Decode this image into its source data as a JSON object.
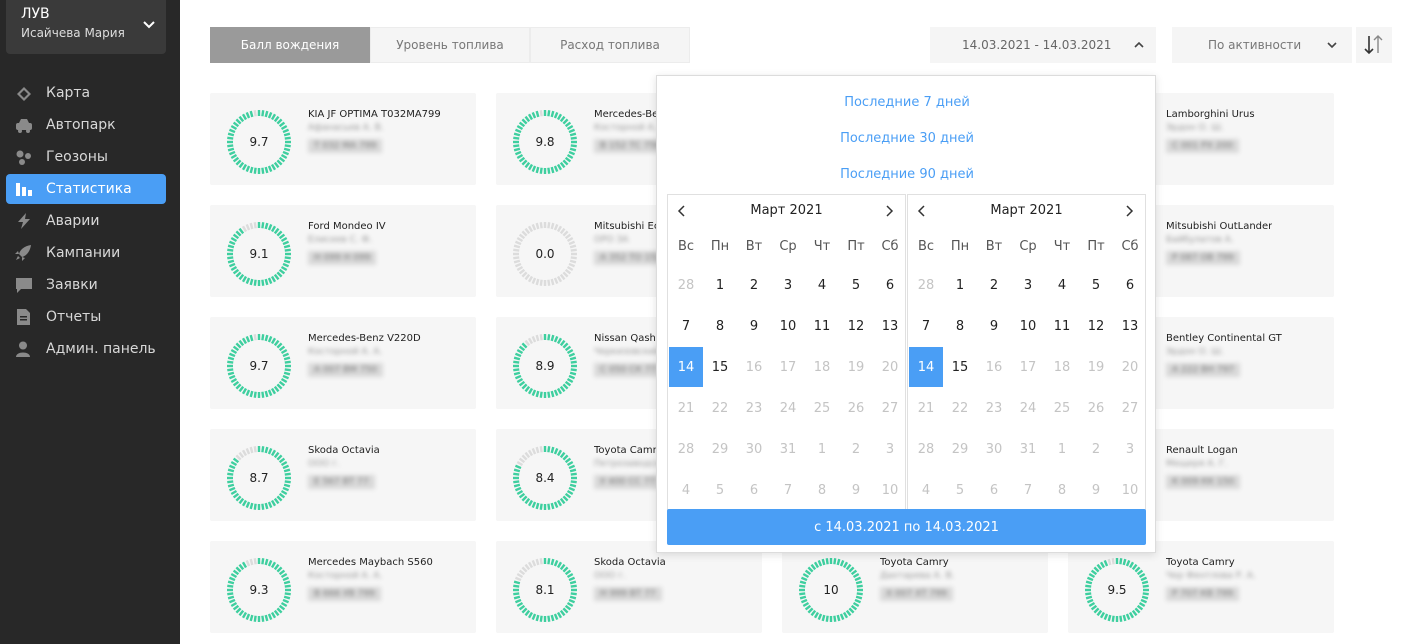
{
  "colors": {
    "accent": "#4a9ef5",
    "gauge_good": "#3ecf9f",
    "gauge_empty": "#dcdcdc",
    "sidebar_bg": "#282828"
  },
  "sidebar": {
    "org_name": "ЛУВ",
    "user_name": "Исайчева Мария",
    "items": [
      {
        "label": "Карта",
        "icon": "map-icon"
      },
      {
        "label": "Автопарк",
        "icon": "car-icon"
      },
      {
        "label": "Геозоны",
        "icon": "geozones-icon"
      },
      {
        "label": "Статистика",
        "icon": "bar-chart-icon",
        "active": true
      },
      {
        "label": "Аварии",
        "icon": "lightning-icon"
      },
      {
        "label": "Кампании",
        "icon": "rocket-icon"
      },
      {
        "label": "Заявки",
        "icon": "chat-icon"
      },
      {
        "label": "Отчеты",
        "icon": "document-icon"
      },
      {
        "label": "Админ. панель",
        "icon": "user-icon"
      }
    ]
  },
  "toolbar": {
    "tabs": [
      "Балл вождения",
      "Уровень топлива",
      "Расход топлива"
    ],
    "active_tab": 0,
    "date_range": "14.03.2021 - 14.03.2021",
    "sort": "По активности",
    "sort_order_icon": "sort-order-icon"
  },
  "cards": [
    {
      "title": "KIA JF OPTIMA T032MA799",
      "driver": "Афанасьев А. В.",
      "plate": "Т 032 МА 799",
      "score": "9.7",
      "fraction": 0.97
    },
    {
      "title": "Mercedes-Be",
      "driver": "Косторной А. А.",
      "plate": "В 152 ТС 750",
      "score": "9.8",
      "fraction": 0.98
    },
    {
      "title": "",
      "driver": "",
      "plate": "",
      "score": "",
      "fraction": 0.9
    },
    {
      "title": "Lamborghini Urus",
      "driver": "Эрдон О. Ш.",
      "plate": "С 001 РХ 200",
      "score": "",
      "fraction": 0.9
    },
    {
      "title": "Ford Mondeo IV",
      "driver": "Елисеев С. Ф.",
      "plate": "Н 099 Н 099",
      "score": "9.1",
      "fraction": 0.91
    },
    {
      "title": "Mitsubishi Ec",
      "driver": "ОРО ЗА",
      "plate": "А 352 ТО 152",
      "score": "0.0",
      "fraction": 0.0
    },
    {
      "title": "",
      "driver": "",
      "plate": "",
      "score": "",
      "fraction": 0.9
    },
    {
      "title": "Mitsubishi OutLander",
      "driver": "Байбулатов А.",
      "plate": "Р 087 ОВ 799",
      "score": "",
      "fraction": 0.9
    },
    {
      "title": "Mercedes-Benz V220D",
      "driver": "Косторной А. А.",
      "plate": "А 007 ВМ 750",
      "score": "9.7",
      "fraction": 0.97
    },
    {
      "title": "Nissan Qasho",
      "driver": "Черкизовский А. В.",
      "plate": "С 050 СК 77",
      "score": "8.9",
      "fraction": 0.89
    },
    {
      "title": "",
      "driver": "",
      "plate": "",
      "score": "",
      "fraction": 0.9
    },
    {
      "title": "Bentley Continental GT",
      "driver": "Эрдон О. Ш.",
      "plate": "А 222 ВН 797",
      "score": "",
      "fraction": 0.9
    },
    {
      "title": "Skoda Octavia",
      "driver": "ООО г.",
      "plate": "Е 567 ВТ 77",
      "score": "8.7",
      "fraction": 0.87
    },
    {
      "title": "Toyota Camry",
      "driver": "Петрозаводский А. В.",
      "plate": "У 400 СС 77",
      "score": "8.4",
      "fraction": 0.84
    },
    {
      "title": "",
      "driver": "",
      "plate": "",
      "score": "",
      "fraction": 0.9
    },
    {
      "title": "Renault Logan",
      "driver": "Мещеря А. Г.",
      "plate": "К 009 КК 150",
      "score": "",
      "fraction": 0.9
    },
    {
      "title": "Mercedes Maybach S560",
      "driver": "Косторной А. А.",
      "plate": "В 666 УВ 799",
      "score": "9.3",
      "fraction": 0.93
    },
    {
      "title": "Skoda Octavia",
      "driver": "ООО г.",
      "plate": "Н 999 ВТ 77",
      "score": "8.1",
      "fraction": 0.81
    },
    {
      "title": "Toyota Camry",
      "driver": "Дахтарева А. В.",
      "plate": "Х 007 ХТ 799",
      "score": "10",
      "fraction": 1.0
    },
    {
      "title": "Toyota Camry",
      "driver": "Чер Фентлова Р. А.",
      "plate": "Р 707 КВ 799",
      "score": "9.5",
      "fraction": 0.95
    }
  ],
  "picker": {
    "presets": [
      "Последние 7 дней",
      "Последние 30 дней",
      "Последние 90 дней"
    ],
    "apply_label": "с 14.03.2021 по 14.03.2021",
    "weekdays": [
      "Вс",
      "Пн",
      "Вт",
      "Ср",
      "Чт",
      "Пт",
      "Сб"
    ],
    "calendars": [
      {
        "month": "Март 2021",
        "days": [
          {
            "d": "28",
            "s": "muted"
          },
          {
            "d": "1"
          },
          {
            "d": "2"
          },
          {
            "d": "3"
          },
          {
            "d": "4"
          },
          {
            "d": "5"
          },
          {
            "d": "6"
          },
          {
            "d": "7"
          },
          {
            "d": "8"
          },
          {
            "d": "9"
          },
          {
            "d": "10"
          },
          {
            "d": "11"
          },
          {
            "d": "12"
          },
          {
            "d": "13"
          },
          {
            "d": "14",
            "s": "selected"
          },
          {
            "d": "15"
          },
          {
            "d": "16",
            "s": "muted"
          },
          {
            "d": "17",
            "s": "muted"
          },
          {
            "d": "18",
            "s": "muted"
          },
          {
            "d": "19",
            "s": "muted"
          },
          {
            "d": "20",
            "s": "muted"
          },
          {
            "d": "21",
            "s": "muted"
          },
          {
            "d": "22",
            "s": "muted"
          },
          {
            "d": "23",
            "s": "muted"
          },
          {
            "d": "24",
            "s": "muted"
          },
          {
            "d": "25",
            "s": "muted"
          },
          {
            "d": "26",
            "s": "muted"
          },
          {
            "d": "27",
            "s": "muted"
          },
          {
            "d": "28",
            "s": "muted"
          },
          {
            "d": "29",
            "s": "muted"
          },
          {
            "d": "30",
            "s": "muted"
          },
          {
            "d": "31",
            "s": "muted"
          },
          {
            "d": "1",
            "s": "muted"
          },
          {
            "d": "2",
            "s": "muted"
          },
          {
            "d": "3",
            "s": "muted"
          },
          {
            "d": "4",
            "s": "muted"
          },
          {
            "d": "5",
            "s": "muted"
          },
          {
            "d": "6",
            "s": "muted"
          },
          {
            "d": "7",
            "s": "muted"
          },
          {
            "d": "8",
            "s": "muted"
          },
          {
            "d": "9",
            "s": "muted"
          },
          {
            "d": "10",
            "s": "muted"
          }
        ]
      },
      {
        "month": "Март 2021",
        "days": [
          {
            "d": "28",
            "s": "muted"
          },
          {
            "d": "1"
          },
          {
            "d": "2"
          },
          {
            "d": "3"
          },
          {
            "d": "4"
          },
          {
            "d": "5"
          },
          {
            "d": "6"
          },
          {
            "d": "7"
          },
          {
            "d": "8"
          },
          {
            "d": "9"
          },
          {
            "d": "10"
          },
          {
            "d": "11"
          },
          {
            "d": "12"
          },
          {
            "d": "13"
          },
          {
            "d": "14",
            "s": "selected"
          },
          {
            "d": "15"
          },
          {
            "d": "16",
            "s": "muted"
          },
          {
            "d": "17",
            "s": "muted"
          },
          {
            "d": "18",
            "s": "muted"
          },
          {
            "d": "19",
            "s": "muted"
          },
          {
            "d": "20",
            "s": "muted"
          },
          {
            "d": "21",
            "s": "muted"
          },
          {
            "d": "22",
            "s": "muted"
          },
          {
            "d": "23",
            "s": "muted"
          },
          {
            "d": "24",
            "s": "muted"
          },
          {
            "d": "25",
            "s": "muted"
          },
          {
            "d": "26",
            "s": "muted"
          },
          {
            "d": "27",
            "s": "muted"
          },
          {
            "d": "28",
            "s": "muted"
          },
          {
            "d": "29",
            "s": "muted"
          },
          {
            "d": "30",
            "s": "muted"
          },
          {
            "d": "31",
            "s": "muted"
          },
          {
            "d": "1",
            "s": "muted"
          },
          {
            "d": "2",
            "s": "muted"
          },
          {
            "d": "3",
            "s": "muted"
          },
          {
            "d": "4",
            "s": "muted"
          },
          {
            "d": "5",
            "s": "muted"
          },
          {
            "d": "6",
            "s": "muted"
          },
          {
            "d": "7",
            "s": "muted"
          },
          {
            "d": "8",
            "s": "muted"
          },
          {
            "d": "9",
            "s": "muted"
          },
          {
            "d": "10",
            "s": "muted"
          }
        ]
      }
    ]
  }
}
